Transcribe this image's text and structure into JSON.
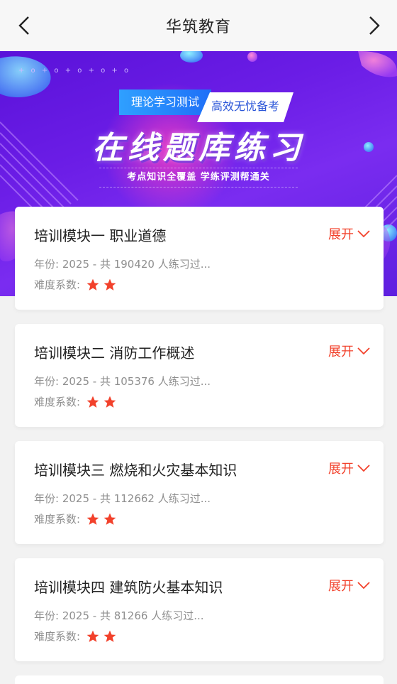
{
  "header": {
    "title": "华筑教育",
    "back_icon": "chevron-left-icon",
    "forward_icon": "chevron-right-icon"
  },
  "banner": {
    "tag_left": "理论学习测试",
    "tag_right": "高效无忧备考",
    "title": "在线题库练习",
    "subtitle": "考点知识全覆盖 学练评测帮通关",
    "dots": "+ o + o + o + o + o"
  },
  "colors": {
    "accent": "#f2412b",
    "banner_purple": "#6b1de6",
    "tag_blue": "#1e6ff7"
  },
  "modules": [
    {
      "title": "培训模块一 职业道德",
      "meta": "年份: 2025 - 共 190420 人练习过...",
      "difficulty_label": "难度系数:",
      "stars": 2,
      "expand_label": "展开"
    },
    {
      "title": "培训模块二 消防工作概述",
      "meta": "年份: 2025 - 共 105376 人练习过...",
      "difficulty_label": "难度系数:",
      "stars": 2,
      "expand_label": "展开"
    },
    {
      "title": "培训模块三 燃烧和火灾基本知识",
      "meta": "年份: 2025 - 共 112662 人练习过...",
      "difficulty_label": "难度系数:",
      "stars": 2,
      "expand_label": "展开"
    },
    {
      "title": "培训模块四 建筑防火基本知识",
      "meta": "年份: 2025 - 共 81266 人练习过...",
      "difficulty_label": "难度系数:",
      "stars": 2,
      "expand_label": "展开"
    }
  ]
}
